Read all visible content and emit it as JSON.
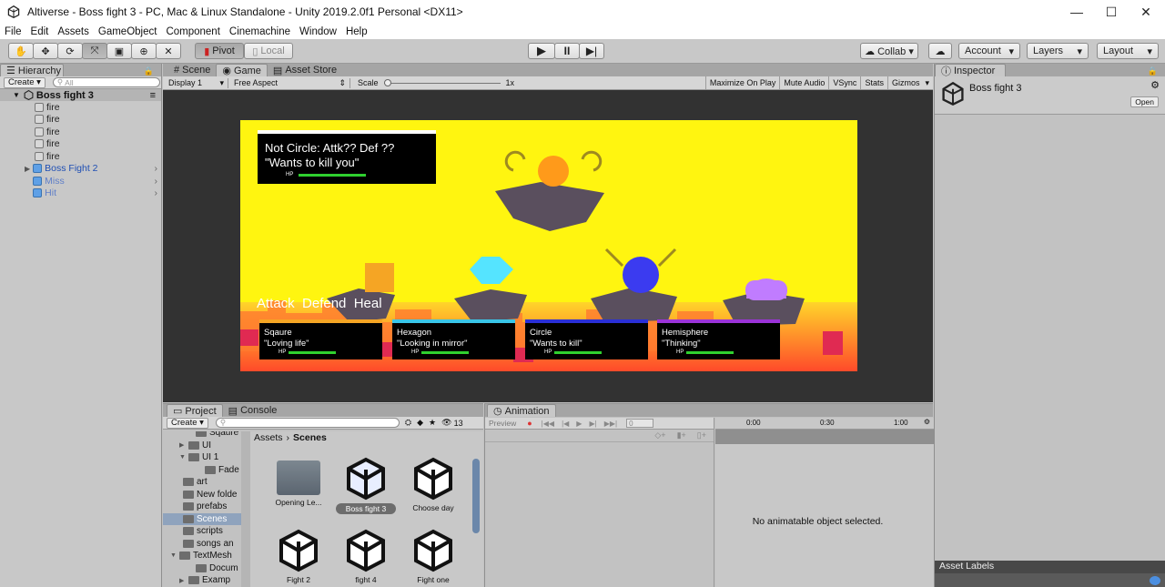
{
  "window": {
    "title": "Altiverse - Boss fight 3 - PC, Mac & Linux Standalone - Unity 2019.2.0f1 Personal <DX11>",
    "minimize": "—",
    "maximize": "☐",
    "close": "✕"
  },
  "menu": [
    "File",
    "Edit",
    "Assets",
    "GameObject",
    "Component",
    "Cinemachine",
    "Window",
    "Help"
  ],
  "toolbar": {
    "pivot": "Pivot",
    "local": "Local",
    "collab": "Collab ▾",
    "account": "Account",
    "layers": "Layers",
    "layout": "Layout"
  },
  "hierarchy": {
    "tab": "Hierarchy",
    "create": "Create ▾",
    "search_placeholder": "All",
    "scene": "Boss fight 3",
    "items": [
      {
        "label": "fire",
        "blue": false
      },
      {
        "label": "fire",
        "blue": false
      },
      {
        "label": "fire",
        "blue": false
      },
      {
        "label": "fire",
        "blue": false
      },
      {
        "label": "fire",
        "blue": false
      },
      {
        "label": "Boss Fight 2",
        "blue": true
      },
      {
        "label": "Miss",
        "blue": true
      },
      {
        "label": "Hit",
        "blue": true
      }
    ]
  },
  "scene_tabs": {
    "scene": "Scene",
    "game": "Game",
    "asset_store": "Asset Store"
  },
  "game_bar": {
    "display": "Display 1",
    "aspect": "Free Aspect",
    "scale_label": "Scale",
    "scale_value": "1x",
    "maximize": "Maximize On Play",
    "mute": "Mute Audio",
    "vsync": "VSync",
    "stats": "Stats",
    "gizmos": "Gizmos"
  },
  "game": {
    "enemy": {
      "line1": "Not Circle: Attk?? Def ??",
      "line2": "\"Wants to kill you\"",
      "hp_label": "HP"
    },
    "actions": "Attack  Defend  Heal",
    "party": [
      {
        "name": "Sqaure",
        "status": "\"Loving life\"",
        "hp_label": "HP",
        "accent": "#f5a524",
        "hp": 1.0
      },
      {
        "name": "Hexagon",
        "status": "\"Looking in mirror\"",
        "hp_label": "HP",
        "accent": "#39c5e8",
        "hp": 1.0
      },
      {
        "name": "Circle",
        "status": "\"Wants to kill\"",
        "hp_label": "HP",
        "accent": "#2a2fd6",
        "hp": 1.0
      },
      {
        "name": "Hemisphere",
        "status": "\"Thinking\"",
        "hp_label": "HP",
        "accent": "#9b33d8",
        "hp": 1.0
      }
    ]
  },
  "inspector": {
    "tab": "Inspector",
    "object": "Boss fight 3",
    "open": "Open",
    "asset_labels": "Asset Labels"
  },
  "project": {
    "tab": "Project",
    "console_tab": "Console",
    "create": "Create ▾",
    "count": "13",
    "tree": [
      "Sqaure",
      "UI",
      "UI 1",
      "Fade",
      "art",
      "New folde",
      "prefabs",
      "Scenes",
      "scripts",
      "songs an",
      "TextMesh",
      "Docum",
      "Examp"
    ],
    "breadcrumb_root": "Assets",
    "breadcrumb_current": "Scenes",
    "assets": [
      "Opening Le...",
      "Boss fight 3",
      "Choose day",
      "Fight 2",
      "fight 4",
      "Fight one"
    ]
  },
  "animation": {
    "tab": "Animation",
    "preview": "Preview",
    "frame": "0",
    "t0": "0:00",
    "t1": "0:30",
    "t2": "1:00",
    "empty": "No animatable object selected."
  }
}
